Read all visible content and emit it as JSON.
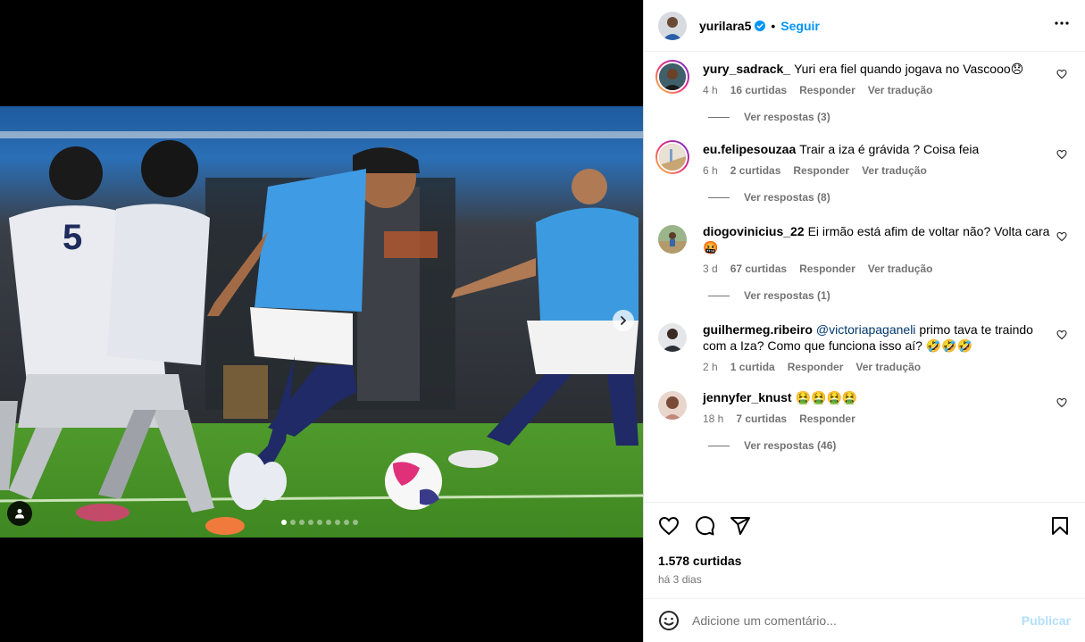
{
  "post": {
    "username": "yurilara5",
    "follow_label": "Seguir",
    "separator": "•"
  },
  "carousel": {
    "total": 9,
    "current": 1
  },
  "comments": [
    {
      "username": "yury_sadrack_",
      "text": "Yuri era fiel quando jogava no Vascooo😞",
      "time": "4 h",
      "likes": "16 curtidas",
      "reply": "Responder",
      "translate": "Ver tradução",
      "replies": "Ver respostas (3)"
    },
    {
      "username": "eu.felipesouzaa",
      "text": "Trair a iza é grávida ? Coisa feia",
      "time": "6 h",
      "likes": "2 curtidas",
      "reply": "Responder",
      "translate": "Ver tradução",
      "replies": "Ver respostas (8)"
    },
    {
      "username": "diogovinicius_22",
      "text": "Ei irmão está afim de voltar não? Volta cara 🤬",
      "time": "3 d",
      "likes": "67 curtidas",
      "reply": "Responder",
      "translate": "Ver tradução",
      "replies": "Ver respostas (1)"
    },
    {
      "username": "guilhermeg.ribeiro",
      "mention": "@victoriapaganeli",
      "text": "primo tava te traindo com a Iza? Como que funciona isso aí? 🤣🤣🤣",
      "time": "2 h",
      "likes": "1 curtida",
      "reply": "Responder",
      "translate": "Ver tradução"
    },
    {
      "username": "jennyfer_knust",
      "text": "🤮🤮🤮🤮",
      "time": "18 h",
      "likes": "7 curtidas",
      "reply": "Responder",
      "replies": "Ver respostas (46)"
    }
  ],
  "footer": {
    "likes_count": "1.578 curtidas",
    "date": "há 3 dias",
    "comment_placeholder": "Adicione um comentário...",
    "post_label": "Publicar"
  },
  "icons": {
    "like": "heart-icon",
    "comment": "comment-icon",
    "share": "share-icon",
    "save": "bookmark-icon",
    "emoji": "emoji-icon",
    "more": "more-icon",
    "verified": "verified-badge-icon",
    "next": "chevron-right-icon",
    "tag": "user-tag-icon"
  },
  "colors": {
    "accent": "#0095f6",
    "muted": "#737373",
    "post_disabled": "#b2dffc"
  }
}
